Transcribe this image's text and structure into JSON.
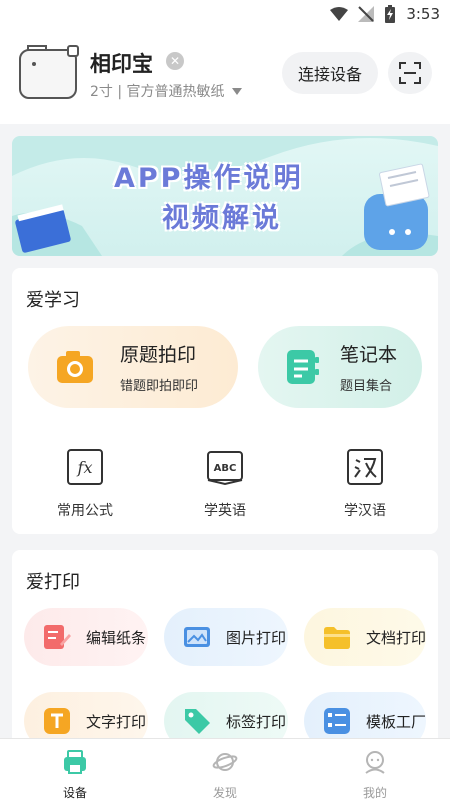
{
  "status": {
    "time": "3:53"
  },
  "device": {
    "name": "相印宝",
    "subtitle": "2寸 | 官方普通热敏纸"
  },
  "header": {
    "connect_label": "连接设备"
  },
  "banner": {
    "line1": "APP操作说明",
    "line2": "视频解说"
  },
  "learn": {
    "title": "爱学习",
    "big_tiles": [
      {
        "label": "原题拍印",
        "sub": "错题即拍即印",
        "icon": "camera-icon",
        "color": "#f5a623"
      },
      {
        "label": "笔记本",
        "sub": "题目集合",
        "icon": "notebook-icon",
        "color": "#3cc9a6"
      }
    ],
    "tools": [
      {
        "label": "常用公式",
        "icon": "formula-icon"
      },
      {
        "label": "学英语",
        "icon": "abc-book-icon"
      },
      {
        "label": "学汉语",
        "icon": "chinese-char-icon"
      }
    ]
  },
  "print": {
    "title": "爱打印",
    "items": [
      {
        "label": "编辑纸条",
        "icon": "edit-note-icon",
        "color": "#f26b6b"
      },
      {
        "label": "图片打印",
        "icon": "image-icon",
        "color": "#4a90e2"
      },
      {
        "label": "文档打印",
        "icon": "folder-icon",
        "color": "#f5c02a"
      },
      {
        "label": "文字打印",
        "icon": "text-t-icon",
        "color": "#f5a623"
      },
      {
        "label": "标签打印",
        "icon": "tag-icon",
        "color": "#3cc9a6"
      },
      {
        "label": "模板工厂",
        "icon": "template-icon",
        "color": "#4a90e2"
      }
    ]
  },
  "tabs": [
    {
      "label": "设备",
      "icon": "printer-icon",
      "active": true
    },
    {
      "label": "发现",
      "icon": "planet-icon",
      "active": false
    },
    {
      "label": "我的",
      "icon": "profile-icon",
      "active": false
    }
  ],
  "colors": {
    "accent": "#3cc9a6",
    "banner_text": "#6b7ad8"
  }
}
